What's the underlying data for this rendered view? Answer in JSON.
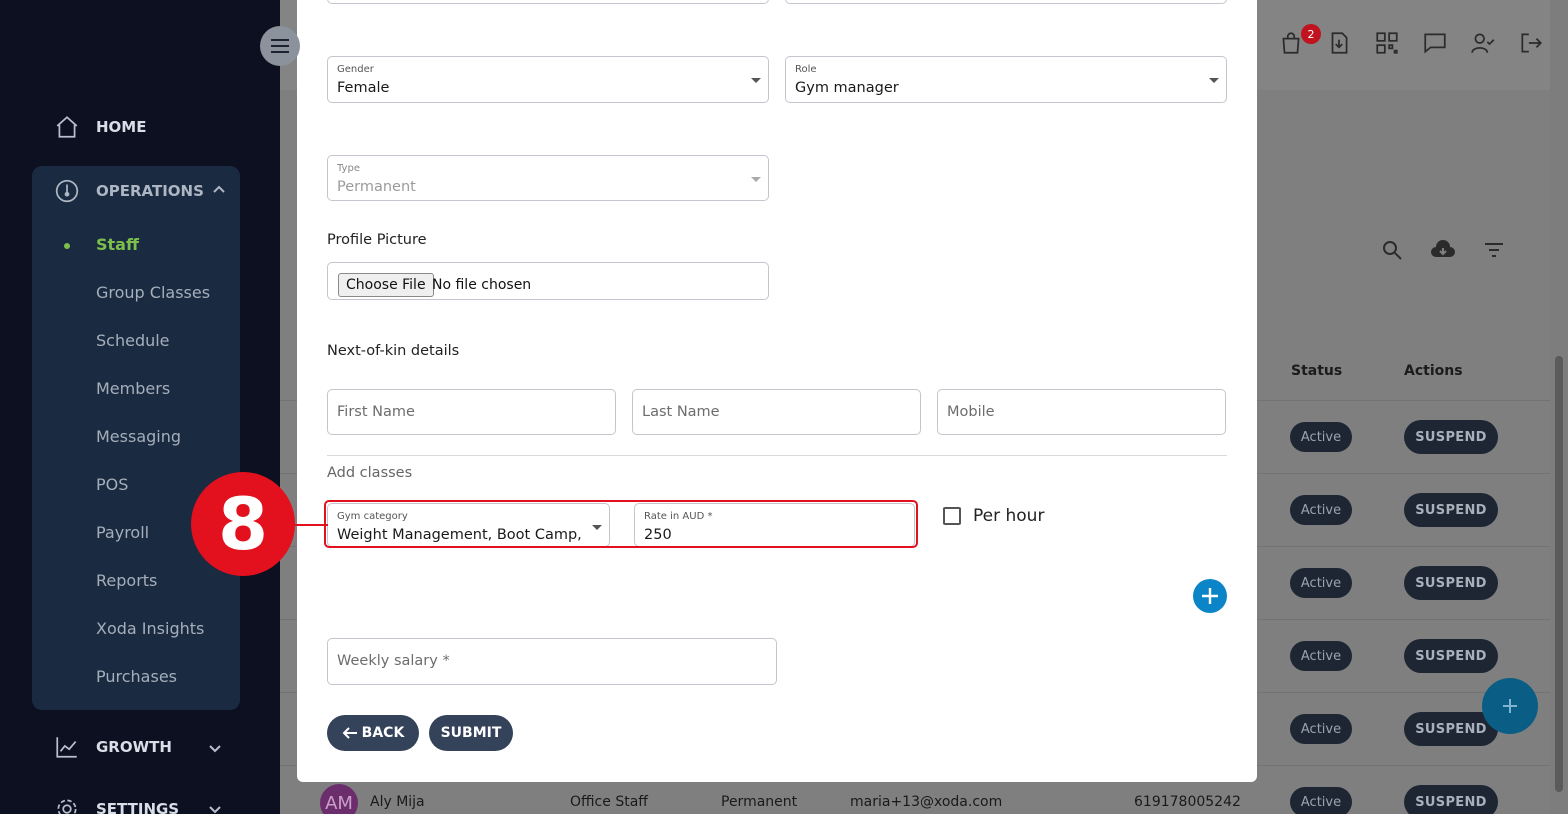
{
  "sidebar": {
    "home_label": "HOME",
    "operations_label": "OPERATIONS",
    "operations_items": [
      "Staff",
      "Group Classes",
      "Schedule",
      "Members",
      "Messaging",
      "POS",
      "Payroll",
      "Reports",
      "Xoda Insights",
      "Purchases"
    ],
    "active_item": "Staff",
    "growth_label": "GROWTH",
    "settings_label": "SETTINGS"
  },
  "header": {
    "notification_count": "2"
  },
  "table": {
    "status_header": "Status",
    "actions_header": "Actions",
    "status_value": "Active",
    "suspend_label": "SUSPEND",
    "last_row": {
      "avatar": "AM",
      "name": "Aly Mija",
      "role": "Office Staff",
      "type": "Permanent",
      "email": "maria+13@xoda.com",
      "phone": "619178005242"
    }
  },
  "form": {
    "gender": {
      "label": "Gender",
      "value": "Female"
    },
    "role": {
      "label": "Role",
      "value": "Gym manager"
    },
    "type": {
      "label": "Type",
      "value": "Permanent"
    },
    "profile_picture_label": "Profile Picture",
    "file_button": "Choose File",
    "file_status": "No file chosen",
    "next_of_kin_label": "Next-of-kin details",
    "kin_first_name": "First Name",
    "kin_last_name": "Last Name",
    "kin_mobile": "Mobile",
    "add_classes_label": "Add classes",
    "gym_category": {
      "label": "Gym category",
      "value": "Weight Management, Boot Camp, R..."
    },
    "rate": {
      "label": "Rate in AUD *",
      "value": "250"
    },
    "per_hour_label": "Per hour",
    "weekly_salary_placeholder": "Weekly salary *",
    "back_label": "BACK",
    "submit_label": "SUBMIT"
  },
  "step_marker": "8",
  "colors": {
    "sidebar_bg": "#0c1021",
    "ops_bg": "#1a2a40",
    "active_green": "#7cc04b",
    "button_dark": "#34425a",
    "highlight_red": "#e3101e",
    "add_blue": "#0b84c8"
  }
}
